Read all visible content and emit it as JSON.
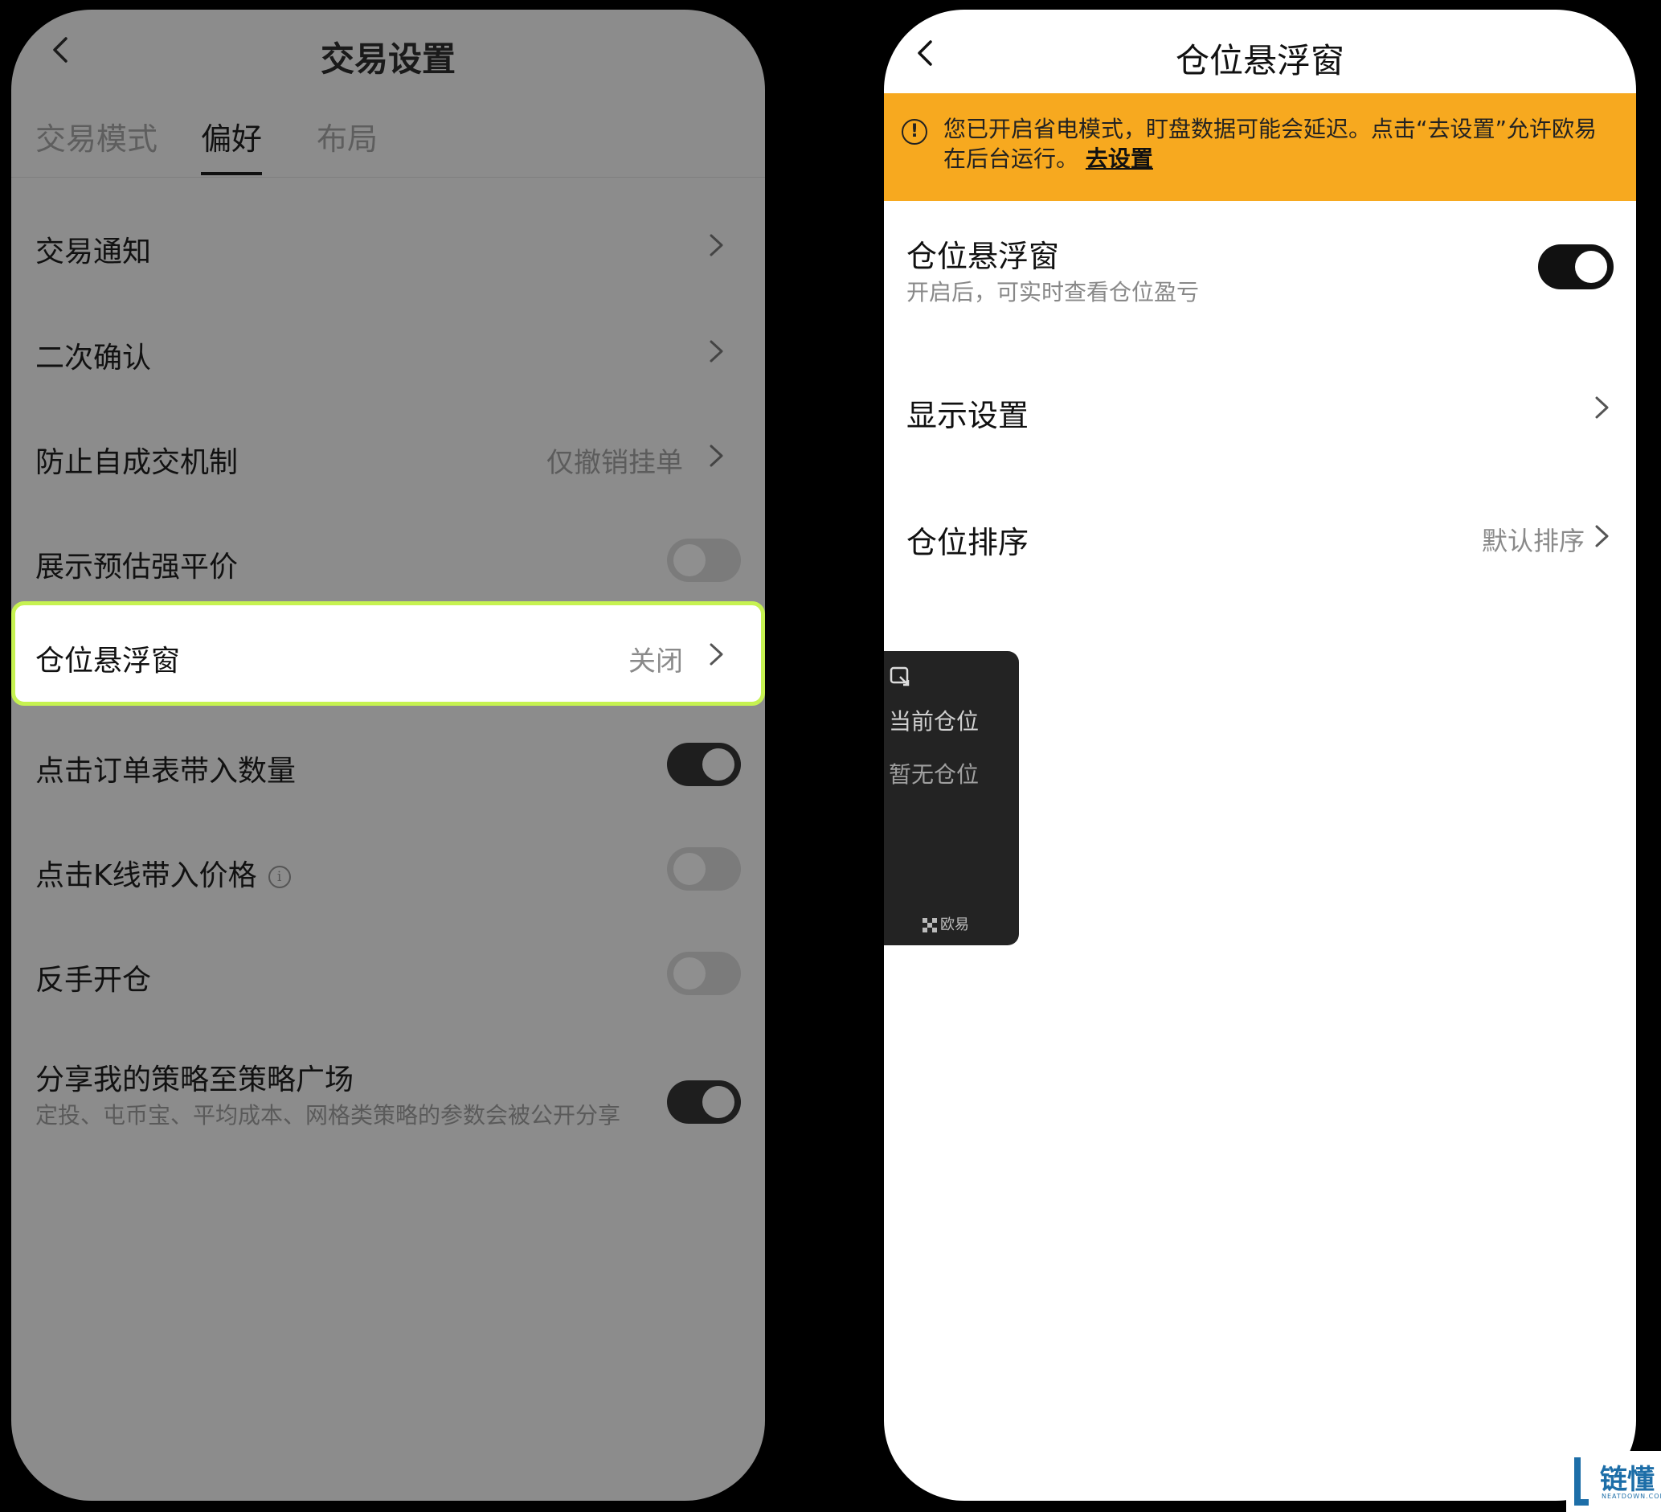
{
  "left": {
    "title": "交易设置",
    "back_icon": "chevron-left-icon",
    "tabs": [
      {
        "label": "交易模式",
        "active": false
      },
      {
        "label": "偏好",
        "active": true
      },
      {
        "label": "布局",
        "active": false
      }
    ],
    "rows": [
      {
        "label": "交易通知"
      },
      {
        "label": "二次确认"
      },
      {
        "label": "防止自成交机制",
        "value": "仅撤销挂单"
      },
      {
        "label": "展示预估强平价",
        "toggle": "off"
      },
      {
        "label": "仓位悬浮窗",
        "value": "关闭"
      },
      {
        "label": "点击订单表带入数量",
        "toggle": "on"
      },
      {
        "label": "点击K线带入价格",
        "toggle": "off",
        "info_icon": "info-icon"
      },
      {
        "label": "反手开仓",
        "toggle": "off"
      },
      {
        "label": "分享我的策略至策略广场",
        "toggle": "on",
        "sub": "定投、屯币宝、平均成本、网格类策略的参数会被公开分享"
      }
    ]
  },
  "right": {
    "title": "仓位悬浮窗",
    "banner": {
      "text": "您已开启省电模式，盯盘数据可能会延迟。点击“去设置”允许欧易在后台运行。",
      "link": "去设置",
      "bg_color": "#f7a91f"
    },
    "floating_window": {
      "toggle_label": "仓位悬浮窗",
      "toggle_sub": "开启后，可实时查看仓位盈亏",
      "toggle": "on"
    },
    "display_settings": {
      "label": "显示设置"
    },
    "sort": {
      "label": "仓位排序",
      "value": "默认排序"
    },
    "preview": {
      "title": "当前仓位",
      "empty": "暂无仓位",
      "brand": "欧易"
    }
  },
  "watermark": {
    "text": "链懂",
    "sub": "NEATDOWN.COM"
  },
  "colors": {
    "accent_highlight": "#c6f251",
    "banner": "#f7a91f"
  }
}
